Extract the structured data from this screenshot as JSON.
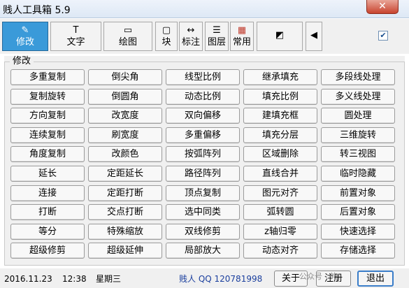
{
  "window": {
    "title": "贱人工具箱 5.9",
    "close_label": "✕"
  },
  "toolbar": {
    "buttons": [
      {
        "id": "modify",
        "icon": "✎",
        "label": "修改",
        "active": true
      },
      {
        "id": "text",
        "icon": "T",
        "label": "文字"
      },
      {
        "id": "draw",
        "icon": "▭",
        "label": "绘图"
      },
      {
        "id": "block",
        "icon": "▢",
        "label": "块"
      },
      {
        "id": "dim",
        "icon": "↔",
        "label": "标注"
      },
      {
        "id": "layer",
        "icon": "☰",
        "label": "图层"
      },
      {
        "id": "common",
        "icon": "▦",
        "label": "常用"
      },
      {
        "id": "more",
        "icon": "◩",
        "label": ""
      },
      {
        "id": "collapse",
        "icon": "◀",
        "label": ""
      }
    ],
    "checkbox_checked": true,
    "checkbox_mark": "✔"
  },
  "panel": {
    "group_label": "修改",
    "commands": [
      [
        "多重复制",
        "倒尖角",
        "线型比例",
        "继承填充",
        "多段线处理"
      ],
      [
        "复制旋转",
        "倒圆角",
        "动态比例",
        "填充比例",
        "多义线处理"
      ],
      [
        "方向复制",
        "改宽度",
        "双向偏移",
        "建填充框",
        "圆处理"
      ],
      [
        "连续复制",
        "刷宽度",
        "多重偏移",
        "填充分层",
        "三维旋转"
      ],
      [
        "角度复制",
        "改颜色",
        "按弧阵列",
        "区域删除",
        "转三视图"
      ],
      [
        "延长",
        "定距延长",
        "路径阵列",
        "直线合并",
        "临时隐藏"
      ],
      [
        "连接",
        "定距打断",
        "顶点复制",
        "图元对齐",
        "前置对象"
      ],
      [
        "打断",
        "交点打断",
        "选中同类",
        "弧转圆",
        "后置对象"
      ],
      [
        "等分",
        "特殊缩放",
        "双线修剪",
        "z轴归零",
        "快速选择"
      ],
      [
        "超级修剪",
        "超级延伸",
        "局部放大",
        "动态对齐",
        "存储选择"
      ]
    ]
  },
  "status": {
    "date": "2016.11.23",
    "time": "12:38",
    "weekday": "星期三",
    "author": "贱人 QQ 120781998",
    "about_label": "关于",
    "register_label": "注册",
    "exit_label": "退出",
    "watermark": "公众号 · 外"
  }
}
